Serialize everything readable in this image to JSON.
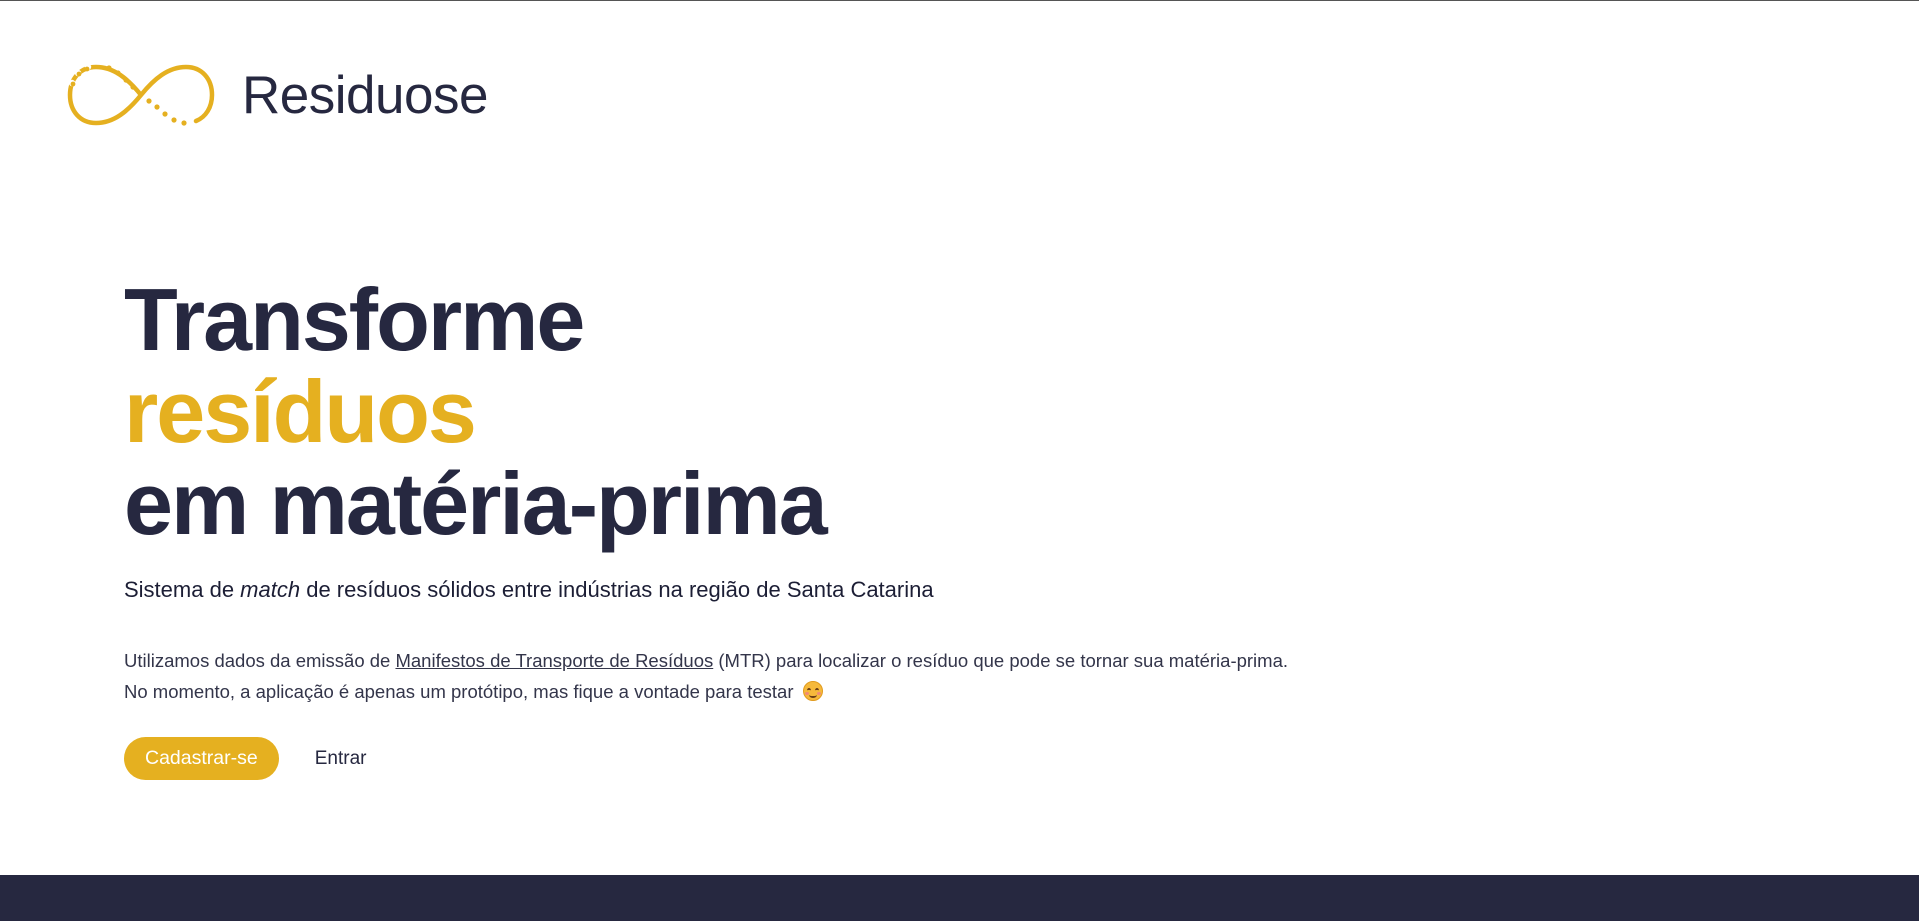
{
  "brand": {
    "name": "Residuose",
    "logo_icon": "infinity-icon",
    "accent_color": "#e5b020",
    "dark_color": "#262840"
  },
  "hero": {
    "title_line1": "Transforme",
    "title_line2": "resíduos",
    "title_line3": "em matéria-prima",
    "subtitle_prefix": "Sistema de ",
    "subtitle_em": "match",
    "subtitle_suffix": " de resíduos sólidos entre indústrias na região de Santa Catarina",
    "desc_prefix": "Utilizamos dados da emissão de ",
    "desc_link": "Manifestos de Transporte de Resíduos",
    "desc_suffix": " (MTR) para localizar o resíduo que pode se tornar sua matéria-prima.",
    "desc_line2": "No momento, a aplicação é apenas um protótipo, mas fique a vontade para testar",
    "emoji_icon": "smiling-face-icon"
  },
  "actions": {
    "signup_label": "Cadastrar-se",
    "login_label": "Entrar"
  }
}
